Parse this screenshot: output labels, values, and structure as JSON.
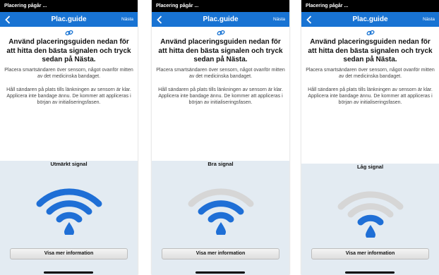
{
  "screens": [
    {
      "status": "Placering pågår ...",
      "nav": {
        "title": "Plac.guide",
        "next": "Nästa"
      },
      "heading": "Använd placeringsguiden nedan för att hitta den bästa signalen och tryck sedan på Nästa.",
      "paragraph1": "Placera smartsändaren över sensorn, något ovanför mitten av det medicinska bandaget.",
      "paragraph2": "Håll sändaren på plats tills länkningen av sensorn är klar. Applicera inte bandage ännu. De kommer att appliceras i början av initialiseringsfasen.",
      "signal_label": "Utmärkt signal",
      "signal_level": 3,
      "button": "Visa mer information"
    },
    {
      "status": "Placering pågår ...",
      "nav": {
        "title": "Plac.guide",
        "next": "Nästa"
      },
      "heading": "Använd placeringsguiden nedan för att hitta den bästa signalen och tryck sedan på Nästa.",
      "paragraph1": "Placera smartsändaren över sensorn, något ovanför mitten av det medicinska bandaget.",
      "paragraph2": "Håll sändaren på plats tills länkningen av sensorn är klar. Applicera inte bandage ännu. De kommer att appliceras i början av initialiseringsfasen.",
      "signal_label": "Bra signal",
      "signal_level": 2,
      "button": "Visa mer information"
    },
    {
      "status": "Placering pågår ...",
      "nav": {
        "title": "Plac.guide",
        "next": "Nästa"
      },
      "heading": "Använd placeringsguiden nedan för att hitta den bästa signalen och tryck sedan på Nästa.",
      "paragraph1": "Placera smartsändaren över sensorn, något ovanför mitten av det medicinska bandaget.",
      "paragraph2": "Håll sändaren på plats tills länkningen av sensorn är klar. Applicera inte bandage ännu. De kommer att appliceras i början av initialiseringsfasen.",
      "signal_label": "Låg signal",
      "signal_level": 1,
      "button": "Visa mer information"
    }
  ],
  "colors": {
    "nav_bar": "#1873d3",
    "signal_active": "#1f6fd6",
    "signal_inactive": "#d6d6d6",
    "bottom_panel": "#e3ebf2"
  }
}
